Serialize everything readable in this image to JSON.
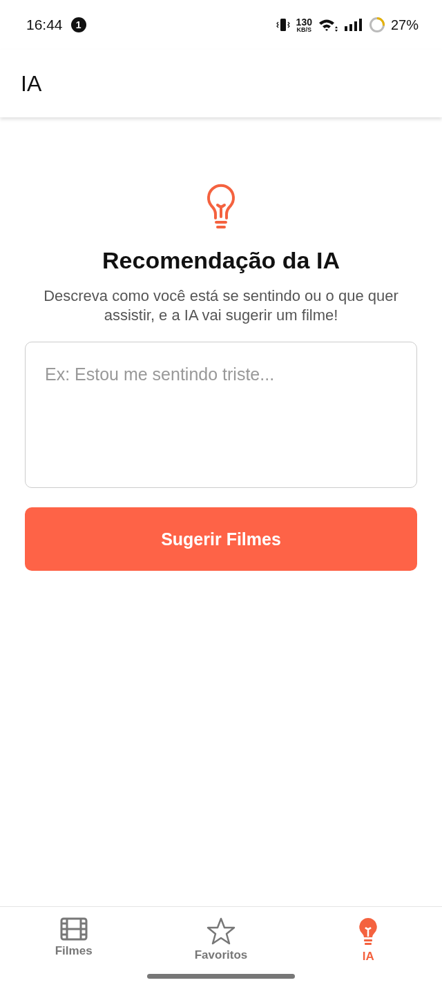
{
  "status_bar": {
    "time": "16:44",
    "notification_count": "1",
    "speed_value": "130",
    "speed_unit": "KB/S",
    "battery": "27%"
  },
  "header": {
    "title": "IA"
  },
  "content": {
    "title": "Recomendação da IA",
    "description": "Descreva como você está se sentindo ou o que quer assistir, e a IA vai sugerir um filme!",
    "input": {
      "placeholder": "Ex: Estou me sentindo triste..."
    },
    "button": "Sugerir Filmes"
  },
  "tabs": [
    {
      "label": "Filmes",
      "kind": "film",
      "selected": false
    },
    {
      "label": "Favoritos",
      "kind": "star",
      "selected": false
    },
    {
      "label": "IA",
      "kind": "bulb",
      "selected": true
    }
  ]
}
